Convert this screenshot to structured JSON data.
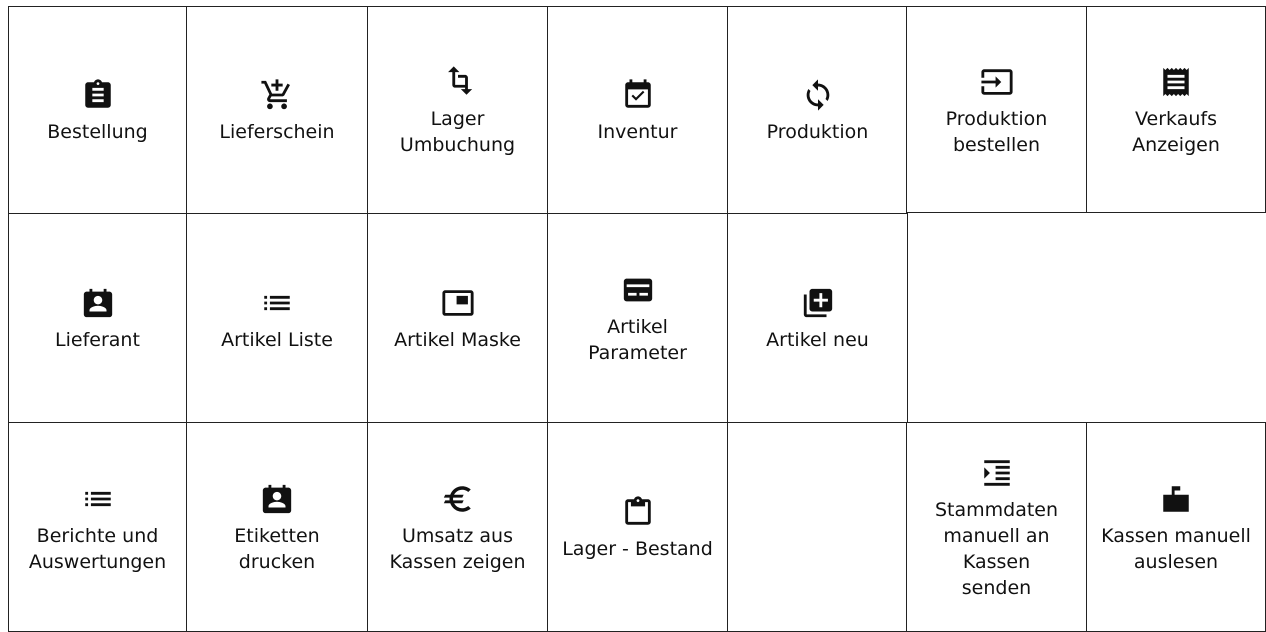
{
  "row1": {
    "bestellung": {
      "label": "Bestellung",
      "icon": "clipboard-list-icon"
    },
    "lieferschein": {
      "label": "Lieferschein",
      "icon": "cart-plus-icon"
    },
    "lager_umbuchung": {
      "label": "Lager Umbuchung",
      "icon": "crop-rotate-icon"
    },
    "inventur": {
      "label": "Inventur",
      "icon": "calendar-check-icon"
    },
    "produktion": {
      "label": "Produktion",
      "icon": "sync-icon"
    },
    "produktion_bestellen": {
      "label": "Produktion bestellen",
      "icon": "input-arrow-icon"
    },
    "verkaufs_anzeigen": {
      "label": "Verkaufs Anzeigen",
      "icon": "receipt-icon"
    }
  },
  "row2": {
    "lieferant": {
      "label": "Lieferant",
      "icon": "contact-badge-icon"
    },
    "artikel_liste": {
      "label": "Artikel Liste",
      "icon": "list-icon"
    },
    "artikel_maske": {
      "label": "Artikel Maske",
      "icon": "picture-in-picture-icon"
    },
    "artikel_parameter": {
      "label": "Artikel Parameter",
      "icon": "card-icon"
    },
    "artikel_neu": {
      "label": "Artikel neu",
      "icon": "library-add-icon"
    }
  },
  "row3": {
    "berichte": {
      "label": "Berichte und Auswertungen",
      "icon": "list-icon"
    },
    "etiketten": {
      "label": "Etiketten drucken",
      "icon": "contact-badge-icon"
    },
    "umsatz": {
      "label": "Umsatz aus Kassen zeigen",
      "icon": "euro-icon"
    },
    "lager_bestand": {
      "label": "Lager - Bestand",
      "icon": "clipboard-outline-icon"
    },
    "stammdaten": {
      "label": "Stammdaten manuell an Kassen senden",
      "icon": "format-indent-icon"
    },
    "kassen_auslesen": {
      "label": "Kassen manuell auslesen",
      "icon": "mailbox-flag-icon"
    }
  }
}
